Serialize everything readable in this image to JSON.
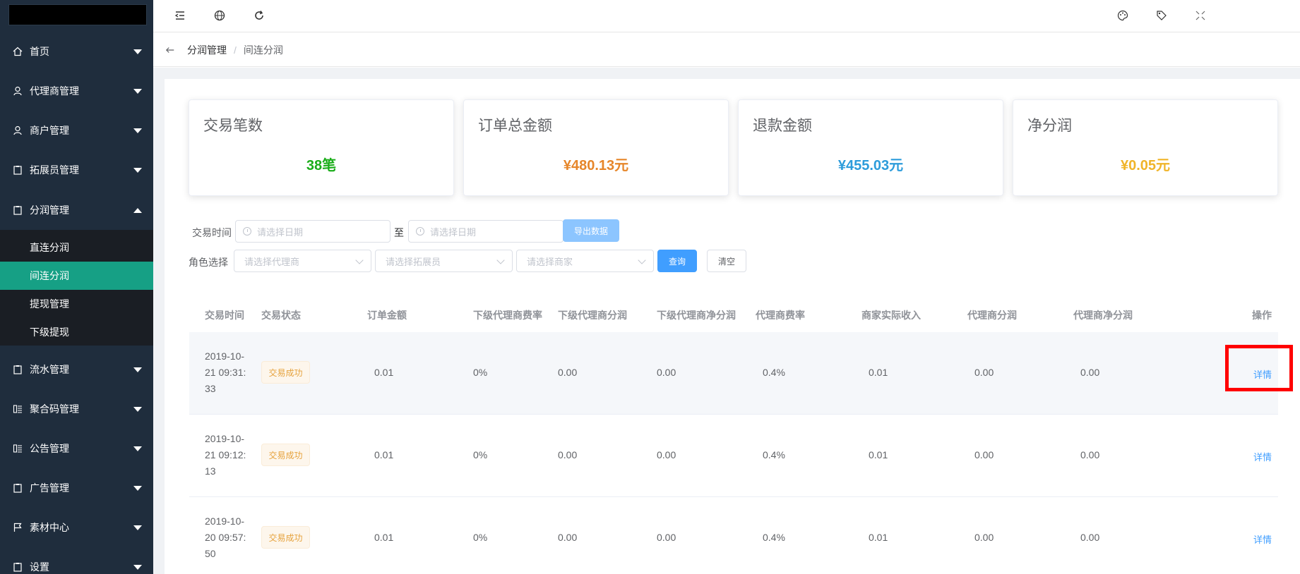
{
  "sidebar": {
    "items": [
      {
        "label": "首页",
        "icon": "home-icon"
      },
      {
        "label": "代理商管理",
        "icon": "user-icon"
      },
      {
        "label": "商户管理",
        "icon": "user-icon"
      },
      {
        "label": "拓展员管理",
        "icon": "clipboard-icon"
      },
      {
        "label": "分润管理",
        "icon": "clipboard-icon"
      },
      {
        "label": "流水管理",
        "icon": "clipboard-icon"
      },
      {
        "label": "聚合码管理",
        "icon": "qr-grid-icon"
      },
      {
        "label": "公告管理",
        "icon": "qr-grid-icon"
      },
      {
        "label": "广告管理",
        "icon": "clipboard-icon"
      },
      {
        "label": "素材中心",
        "icon": "flag-icon"
      },
      {
        "label": "设置",
        "icon": "clipboard-icon"
      }
    ],
    "submenu": [
      "直连分润",
      "间连分润",
      "提现管理",
      "下级提现"
    ],
    "active_sub": "间连分润"
  },
  "topbar": {
    "left_icons": [
      "menu-fold-icon",
      "globe-icon",
      "refresh-icon"
    ],
    "right_icons": [
      "palette-icon",
      "tag-icon",
      "fullscreen-icon"
    ]
  },
  "breadcrumb": {
    "parent": "分润管理",
    "sep": "/",
    "current": "间连分润"
  },
  "stats": [
    {
      "title": "交易笔数",
      "value": "38笔",
      "color": "#1aad19"
    },
    {
      "title": "订单总金额",
      "value": "¥480.13元",
      "color": "#e6862a"
    },
    {
      "title": "退款金额",
      "value": "¥455.03元",
      "color": "#2d9cdb"
    },
    {
      "title": "净分润",
      "value": "¥0.05元",
      "color": "#f0b429"
    }
  ],
  "filters": {
    "time_label": "交易时间",
    "date_placeholder": "请选择日期",
    "to": "至",
    "export": "导出数据",
    "role_label": "角色选择",
    "agent_placeholder": "请选择代理商",
    "expander_placeholder": "请选择拓展员",
    "merchant_placeholder": "请选择商家",
    "query": "查询",
    "clear": "清空"
  },
  "table": {
    "columns": [
      "交易时间",
      "交易状态",
      "订单金额",
      "下级代理商费率",
      "下级代理商分润",
      "下级代理商净分润",
      "代理商费率",
      "商家实际收入",
      "代理商分润",
      "代理商净分润",
      "操作"
    ],
    "rows": [
      {
        "time": [
          "2019-10-",
          "21 09:31:",
          "33"
        ],
        "status": "交易成功",
        "amount": "0.01",
        "sub_rate": "0%",
        "sub_profit": "0.00",
        "sub_net": "0.00",
        "rate": "0.4%",
        "income": "0.01",
        "profit": "0.00",
        "net": "0.00",
        "action": "详情"
      },
      {
        "time": [
          "2019-10-",
          "21 09:12:",
          "13"
        ],
        "status": "交易成功",
        "amount": "0.01",
        "sub_rate": "0%",
        "sub_profit": "0.00",
        "sub_net": "0.00",
        "rate": "0.4%",
        "income": "0.01",
        "profit": "0.00",
        "net": "0.00",
        "action": "详情"
      },
      {
        "time": [
          "2019-10-",
          "20 09:57:",
          "50"
        ],
        "status": "交易成功",
        "amount": "0.01",
        "sub_rate": "0%",
        "sub_profit": "0.00",
        "sub_net": "0.00",
        "rate": "0.4%",
        "income": "0.01",
        "profit": "0.00",
        "net": "0.00",
        "action": "详情"
      }
    ]
  }
}
